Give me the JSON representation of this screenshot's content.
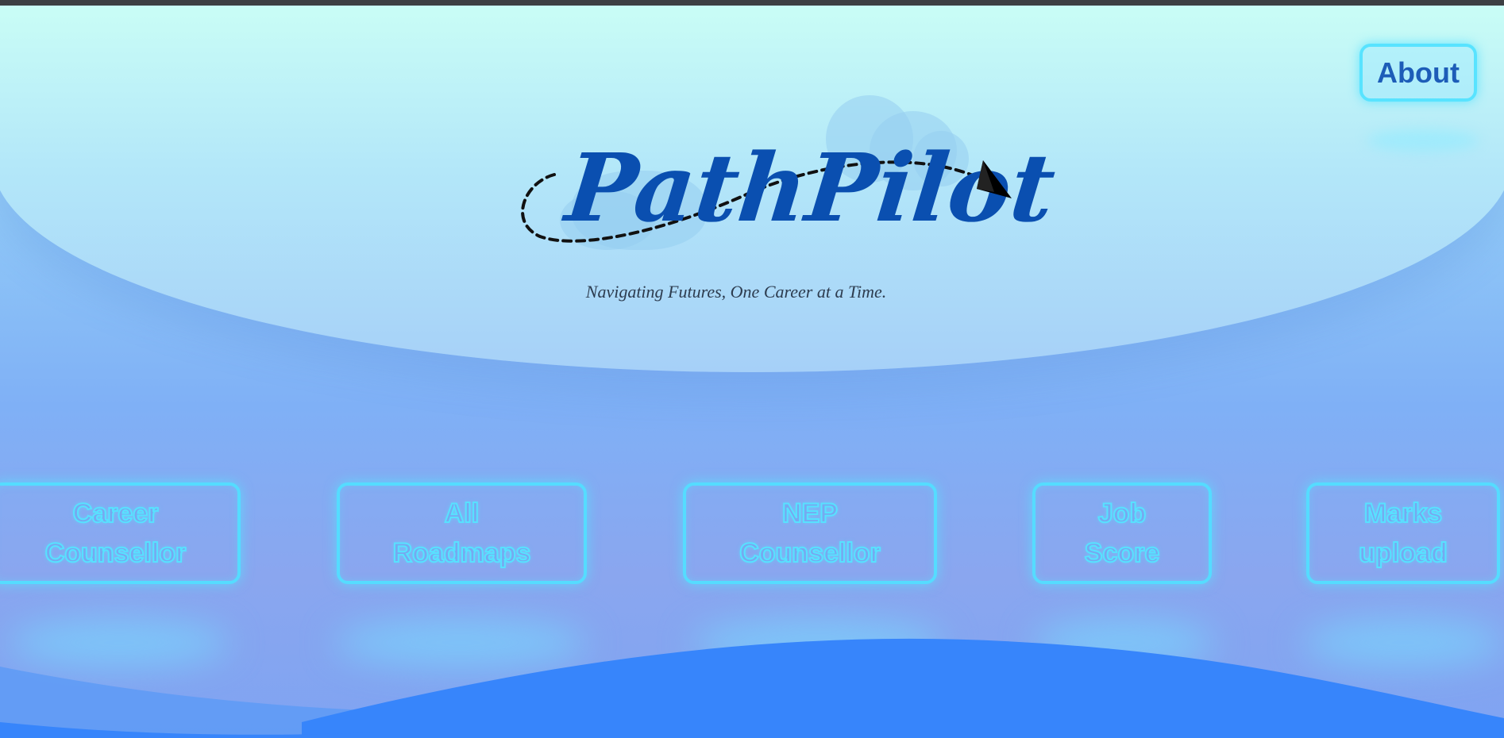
{
  "brand": {
    "name": "PathPilot",
    "tagline": "Navigating Futures, One Career at a Time."
  },
  "header": {
    "about_label": "About"
  },
  "nav": [
    {
      "line1": "Career",
      "line2": "Counsellor"
    },
    {
      "line1": "All",
      "line2": "Roadmaps"
    },
    {
      "line1": "NEP",
      "line2": "Counsellor"
    },
    {
      "line1": "Job",
      "line2": "Score"
    },
    {
      "line1": "Marks",
      "line2": "upload"
    }
  ],
  "colors": {
    "brand_text": "#0a4fb0",
    "neon_accent": "#55dcff",
    "wave_blue": "#3785fb",
    "top_bar": "#3d3f42"
  },
  "icons": [
    "paper-plane-icon",
    "dashed-flight-path",
    "cloud-decoration"
  ]
}
